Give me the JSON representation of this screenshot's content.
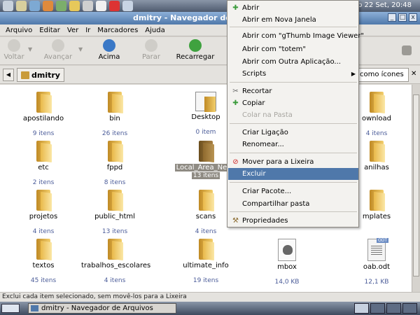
{
  "top_panel": {
    "clock": "b 22 Set, 20:48"
  },
  "window": {
    "title": "dmitry - Navegador de Arquivos"
  },
  "menubar": [
    "Arquivo",
    "Editar",
    "Ver",
    "Ir",
    "Marcadores",
    "Ajuda"
  ],
  "toolbar": {
    "back": "Voltar",
    "forward": "Avançar",
    "up": "Acima",
    "stop": "Parar",
    "reload": "Recarregar"
  },
  "location": {
    "path": "dmitry",
    "view_mode": "como ícones"
  },
  "files": [
    {
      "name": "apostilando",
      "info": "9 itens",
      "kind": "folder"
    },
    {
      "name": "bin",
      "info": "26 itens",
      "kind": "folder"
    },
    {
      "name": "Desktop",
      "info": "0 item",
      "kind": "desktop"
    },
    {
      "name": "ownload",
      "info": "4 itens",
      "kind": "folder"
    },
    {
      "name": "etc",
      "info": "2 itens",
      "kind": "folder"
    },
    {
      "name": "fppd",
      "info": "8 itens",
      "kind": "folder"
    },
    {
      "name": "Local_Area_Netw",
      "info": "13 itens",
      "kind": "folder",
      "selected": true
    },
    {
      "name": "anilhas",
      "info": "",
      "kind": "folder"
    },
    {
      "name": "projetos",
      "info": "4 itens",
      "kind": "folder"
    },
    {
      "name": "public_html",
      "info": "13 itens",
      "kind": "folder"
    },
    {
      "name": "scans",
      "info": "4 itens",
      "kind": "folder"
    },
    {
      "name": "mplates",
      "info": "",
      "kind": "folder"
    },
    {
      "name": "textos",
      "info": "45 itens",
      "kind": "folder"
    },
    {
      "name": "trabalhos_escolares",
      "info": "4 itens",
      "kind": "folder"
    },
    {
      "name": "ultimate_info",
      "info": "19 itens",
      "kind": "folder"
    },
    {
      "name": "mbox",
      "info": "14,0 KB",
      "kind": "doc"
    },
    {
      "name": "oab.odt",
      "info": "12,1 KB",
      "kind": "odt"
    }
  ],
  "context_menu": {
    "items": [
      {
        "label": "Abrir",
        "icon": "plus-icon"
      },
      {
        "label": "Abrir em Nova Janela"
      },
      {
        "label": "Abrir com \"gThumb Image Viewer\""
      },
      {
        "label": "Abrir com \"totem\""
      },
      {
        "label": "Abrir com Outra Aplicação..."
      },
      {
        "label": "Scripts",
        "submenu": true
      },
      {
        "label": "Recortar",
        "icon": "scissors-icon"
      },
      {
        "label": "Copiar",
        "icon": "copy-icon"
      },
      {
        "label": "Colar na Pasta",
        "disabled": true
      },
      {
        "label": "Criar Ligação"
      },
      {
        "label": "Renomear..."
      },
      {
        "label": "Mover para a Lixeira",
        "icon": "no-entry-icon"
      },
      {
        "label": "Excluir",
        "active": true
      },
      {
        "label": "Criar Pacote..."
      },
      {
        "label": "Compartilhar pasta"
      },
      {
        "label": "Propriedades",
        "icon": "properties-icon"
      }
    ]
  },
  "statusbar": "Exclui cada item selecionado, sem movê-los para a Lixeira",
  "taskbar": {
    "task": "dmitry - Navegador de Arquivos"
  },
  "colors": {
    "accent": "#4f78aa",
    "selection": "#8f8b83",
    "info_text": "#4b5c99"
  }
}
